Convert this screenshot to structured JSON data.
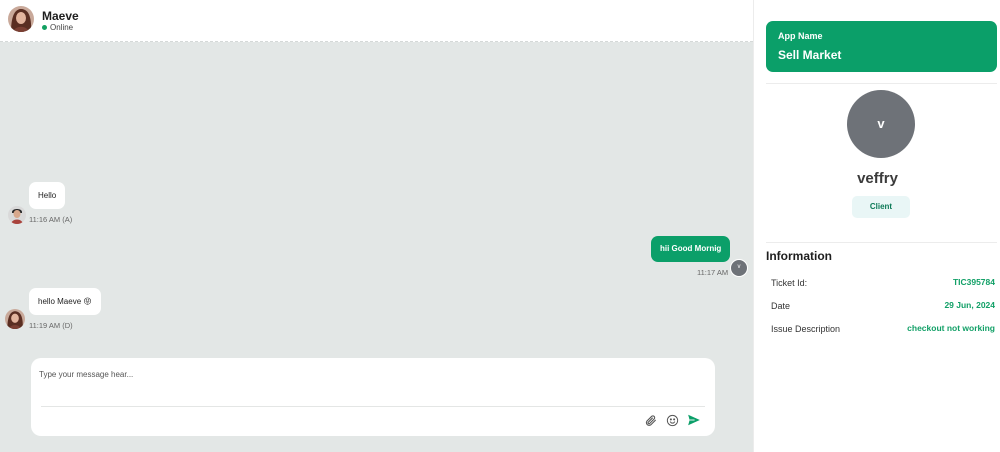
{
  "header": {
    "contact_name": "Maeve",
    "status": "Online"
  },
  "messages": [
    {
      "direction": "incoming",
      "text": "Hello",
      "time": "11:16 AM (A)"
    },
    {
      "direction": "outgoing",
      "text": "hii Good Mornig",
      "time": "11:17 AM",
      "avatar_initial": "v"
    },
    {
      "direction": "incoming",
      "text": "hello Maeve 😝",
      "time": "11:19 AM (D)"
    }
  ],
  "composer": {
    "placeholder": "Type your message hear...",
    "value": "",
    "icons": [
      "paperclip-icon",
      "emoji-icon",
      "send-icon"
    ]
  },
  "panel": {
    "app_label": "App Name",
    "app_name": "Sell Market",
    "avatar_initial": "v",
    "client_name": "veffry",
    "role": "Client",
    "info_title": "Information",
    "info": [
      {
        "label": "Ticket Id:",
        "value": "TIC395784"
      },
      {
        "label": "Date",
        "value": "29 Jun, 2024"
      },
      {
        "label": "Issue Description",
        "value": "checkout not working"
      }
    ]
  },
  "colors": {
    "accent": "#0b9f69",
    "chat_background": "#e3e7e6",
    "avatar_gray": "#6e7278",
    "badge_background": "#e9f6f6"
  }
}
